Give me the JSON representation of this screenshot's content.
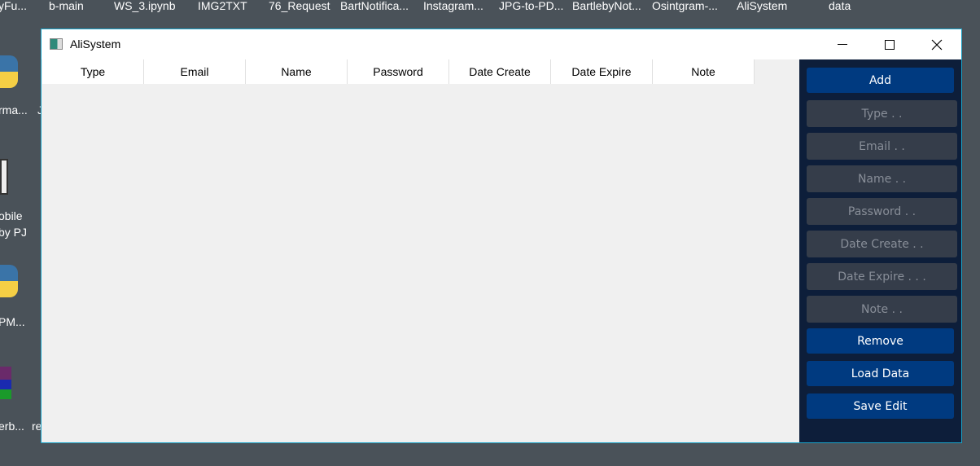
{
  "desktop": {
    "top_icons": [
      "yFu...",
      "b-main",
      "WS_3.ipynb",
      "IMG2TXT",
      "76_Request",
      "BartNotifica...",
      "Instagram...",
      "JPG-to-PD...",
      "BartlebyNot...",
      "Osintgram-...",
      "AliSystem",
      "data"
    ],
    "left_icons": [
      "rma...",
      "J",
      "obile",
      "by PJ",
      "PM...",
      "erb...",
      "re"
    ]
  },
  "window": {
    "title": "AliSystem",
    "icon": "app-window-icon"
  },
  "table": {
    "columns": [
      "Type",
      "Email",
      "Name",
      "Password",
      "Date Create",
      "Date Expire",
      "Note"
    ],
    "rows": []
  },
  "panel": {
    "add": "Add",
    "placeholders": [
      "Type . .",
      "Email . .",
      "Name . .",
      "Password . .",
      "Date Create . .",
      "Date Expire . . .",
      "Note . ."
    ],
    "remove": "Remove",
    "load": "Load Data",
    "save": "Save Edit"
  },
  "colors": {
    "primary_button": "#003a80",
    "panel_bg": "#0d1e3a",
    "field_bg": "#353d4a",
    "window_border": "#1aa3c8"
  }
}
